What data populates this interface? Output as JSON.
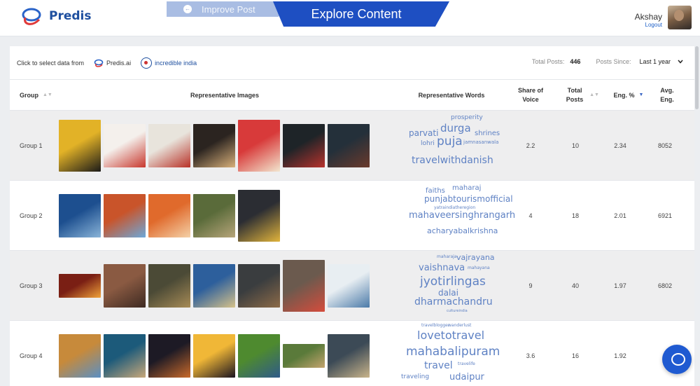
{
  "app": {
    "brand": "Predis"
  },
  "tabs": {
    "improve_label": "Improve Post",
    "explore_label": "Explore Content"
  },
  "user": {
    "name": "Akshay",
    "logout_label": "Logout"
  },
  "filter": {
    "prompt": "Click to select data from",
    "sources": [
      "Predis.ai",
      "incredible india"
    ],
    "active_source": "incredible india",
    "total_posts_label": "Total Posts:",
    "total_posts_value": "446",
    "posts_since_label": "Posts Since:",
    "posts_since_value": "Last 1 year"
  },
  "table": {
    "headers": {
      "group": "Group",
      "images": "Representative Images",
      "words": "Representative Words",
      "share_of_voice": "Share of Voice",
      "total_posts": "Total Posts",
      "eng_pct": "Eng. %",
      "avg_eng": "Avg. Eng."
    },
    "rows": [
      {
        "group": "Group 1",
        "share_of_voice": "2.2",
        "total_posts": "10",
        "eng_pct": "2.34",
        "avg_eng": "8052",
        "image_colors": [
          [
            "#e2b227",
            "#1c1b19"
          ],
          [
            "#f4f0ec",
            "#c8372d"
          ],
          [
            "#e8e4dc",
            "#b83127"
          ],
          [
            "#2b2420",
            "#d8b07a"
          ],
          [
            "#d83a3a",
            "#f2e6cf"
          ],
          [
            "#1e2428",
            "#b8322c"
          ],
          [
            "#24303a",
            "#6b3a2c"
          ]
        ],
        "words": [
          "prosperity",
          "durga",
          "parvati",
          "shrines",
          "lohri",
          "puja",
          "jamnasanwala",
          "travelwithdanish"
        ]
      },
      {
        "group": "Group 2",
        "share_of_voice": "4",
        "total_posts": "18",
        "eng_pct": "2.01",
        "avg_eng": "6921",
        "image_colors": [
          [
            "#1d4f8f",
            "#8ab4d8"
          ],
          [
            "#c9542a",
            "#6da8d9"
          ],
          [
            "#e06a2c",
            "#f4d1a8"
          ],
          [
            "#5a6b3a",
            "#b7a57a"
          ],
          [
            "#2b2d33",
            "#e1b43c"
          ]
        ],
        "words": [
          "faiths",
          "maharaj",
          "punjabtourismofficial",
          "yatraindiatheregion",
          "mahaveersinghrangarh",
          "acharyabalkrishna"
        ]
      },
      {
        "group": "Group 3",
        "share_of_voice": "9",
        "total_posts": "40",
        "eng_pct": "1.97",
        "avg_eng": "6802",
        "image_colors": [
          [
            "#7a1f14",
            "#f0a23a"
          ],
          [
            "#8a5a42",
            "#3d2a22"
          ],
          [
            "#4b4a36",
            "#a78b56"
          ],
          [
            "#2d5f9c",
            "#d6c28a"
          ],
          [
            "#3a3d3f",
            "#8c6a48"
          ],
          [
            "#6b5a4e",
            "#d54c3c"
          ],
          [
            "#e8eef2",
            "#4b7aa8"
          ]
        ],
        "words": [
          "maharaja",
          "vajrayana",
          "vaishnava",
          "mahayana",
          "jyotirlingas",
          "dalai",
          "dharmachandru",
          "cultureindia"
        ]
      },
      {
        "group": "Group 4",
        "share_of_voice": "3.6",
        "total_posts": "16",
        "eng_pct": "1.92",
        "avg_eng": "6",
        "image_colors": [
          [
            "#c78a3b",
            "#5a8fc4"
          ],
          [
            "#1c5a7a",
            "#c9a87a"
          ],
          [
            "#1d1a25",
            "#c96a2b"
          ],
          [
            "#f0b737",
            "#1a1420"
          ],
          [
            "#4e8a2f",
            "#2f5a8a"
          ],
          [
            "#5a7a3a",
            "#c4a46e"
          ],
          [
            "#3c4a56",
            "#c9b48a"
          ]
        ],
        "words": [
          "travelblogger",
          "wanderlust",
          "lovetotravel",
          "mahabalipuram",
          "travel",
          "travelife",
          "traveling",
          "udaipur"
        ]
      }
    ]
  }
}
